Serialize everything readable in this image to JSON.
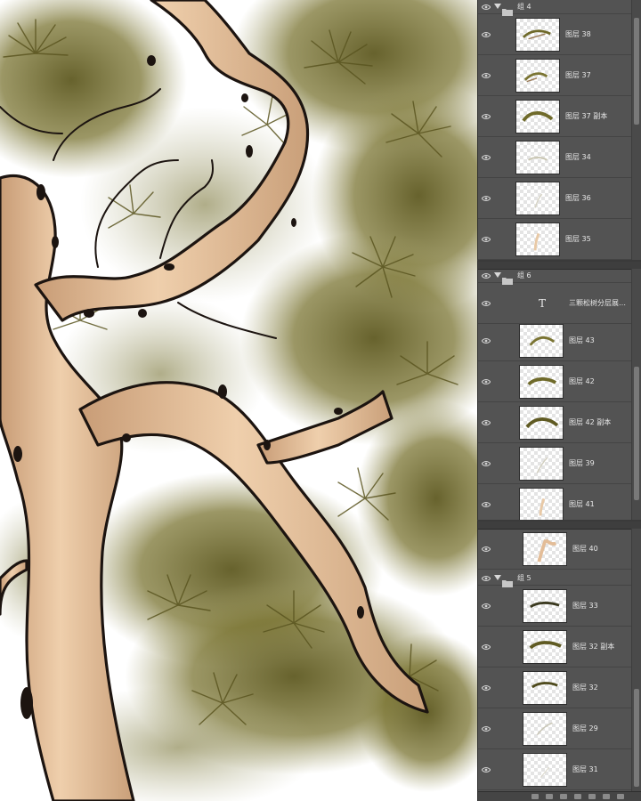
{
  "colors": {
    "panel_bg": "#535353",
    "foliage": "#6f6a2a",
    "foliage_dark": "#4e4a1c",
    "bark": "#e3bd98",
    "bark_shadow": "#c79d78",
    "ink": "#1c1410"
  },
  "icons": {
    "visibility": "eye-icon",
    "group": "folder-icon",
    "collapse": "triangle-down-icon",
    "text_layer": "type-layer-icon"
  },
  "panel_top": {
    "group": {
      "label": "组 4"
    },
    "layers": [
      {
        "label": "图层 38"
      },
      {
        "label": "图层 37"
      },
      {
        "label": "图层 37 副本"
      },
      {
        "label": "图层 34"
      },
      {
        "label": "图层 36"
      },
      {
        "label": "图层 35"
      }
    ]
  },
  "panel_middle": {
    "group": {
      "label": "组 6"
    },
    "text_layer": {
      "label": "三颗松树分层展…",
      "icon_glyph": "T"
    },
    "layers": [
      {
        "label": "图层 43"
      },
      {
        "label": "图层 42"
      },
      {
        "label": "图层 42 副本"
      },
      {
        "label": "图层 39"
      },
      {
        "label": "图层 41"
      }
    ]
  },
  "panel_bottom": {
    "top_layer": {
      "label": "图层 40"
    },
    "group": {
      "label": "组 5"
    },
    "layers": [
      {
        "label": "图层 33"
      },
      {
        "label": "图层 32 副本"
      },
      {
        "label": "图层 32"
      },
      {
        "label": "图层 29"
      },
      {
        "label": "图层 31"
      }
    ]
  }
}
